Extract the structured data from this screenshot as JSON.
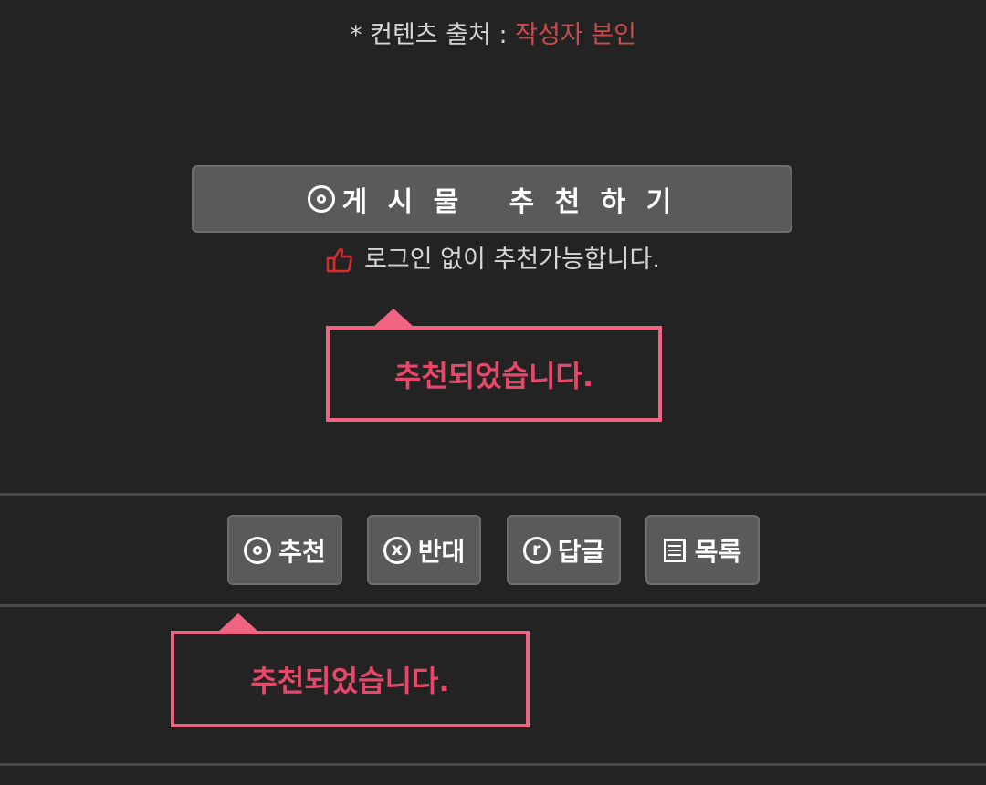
{
  "source": {
    "prefix": "* 컨텐츠 출처 : ",
    "author": "작성자 본인",
    "author_color": "#c94b4b"
  },
  "recommend_button": {
    "label": "게 시 물   추 천 하 기",
    "icon": "circle-o-icon"
  },
  "no_login_note": {
    "icon": "thumbs-up-icon",
    "text": "로그인 없이 추천가능합니다."
  },
  "tooltips": [
    {
      "text": "추천되었습니다."
    },
    {
      "text": "추천되었습니다."
    }
  ],
  "actions": [
    {
      "icon": "circle-o-icon",
      "label": "추천"
    },
    {
      "icon": "circle-x-icon",
      "icon_glyph": "x",
      "label": "반대"
    },
    {
      "icon": "circle-r-icon",
      "icon_glyph": "r",
      "label": "답글"
    },
    {
      "icon": "list-icon",
      "label": "목록"
    }
  ],
  "colors": {
    "background": "#232323",
    "button": "#5a5a5a",
    "tooltip_border": "#f06482",
    "tooltip_text": "#e8476a"
  }
}
